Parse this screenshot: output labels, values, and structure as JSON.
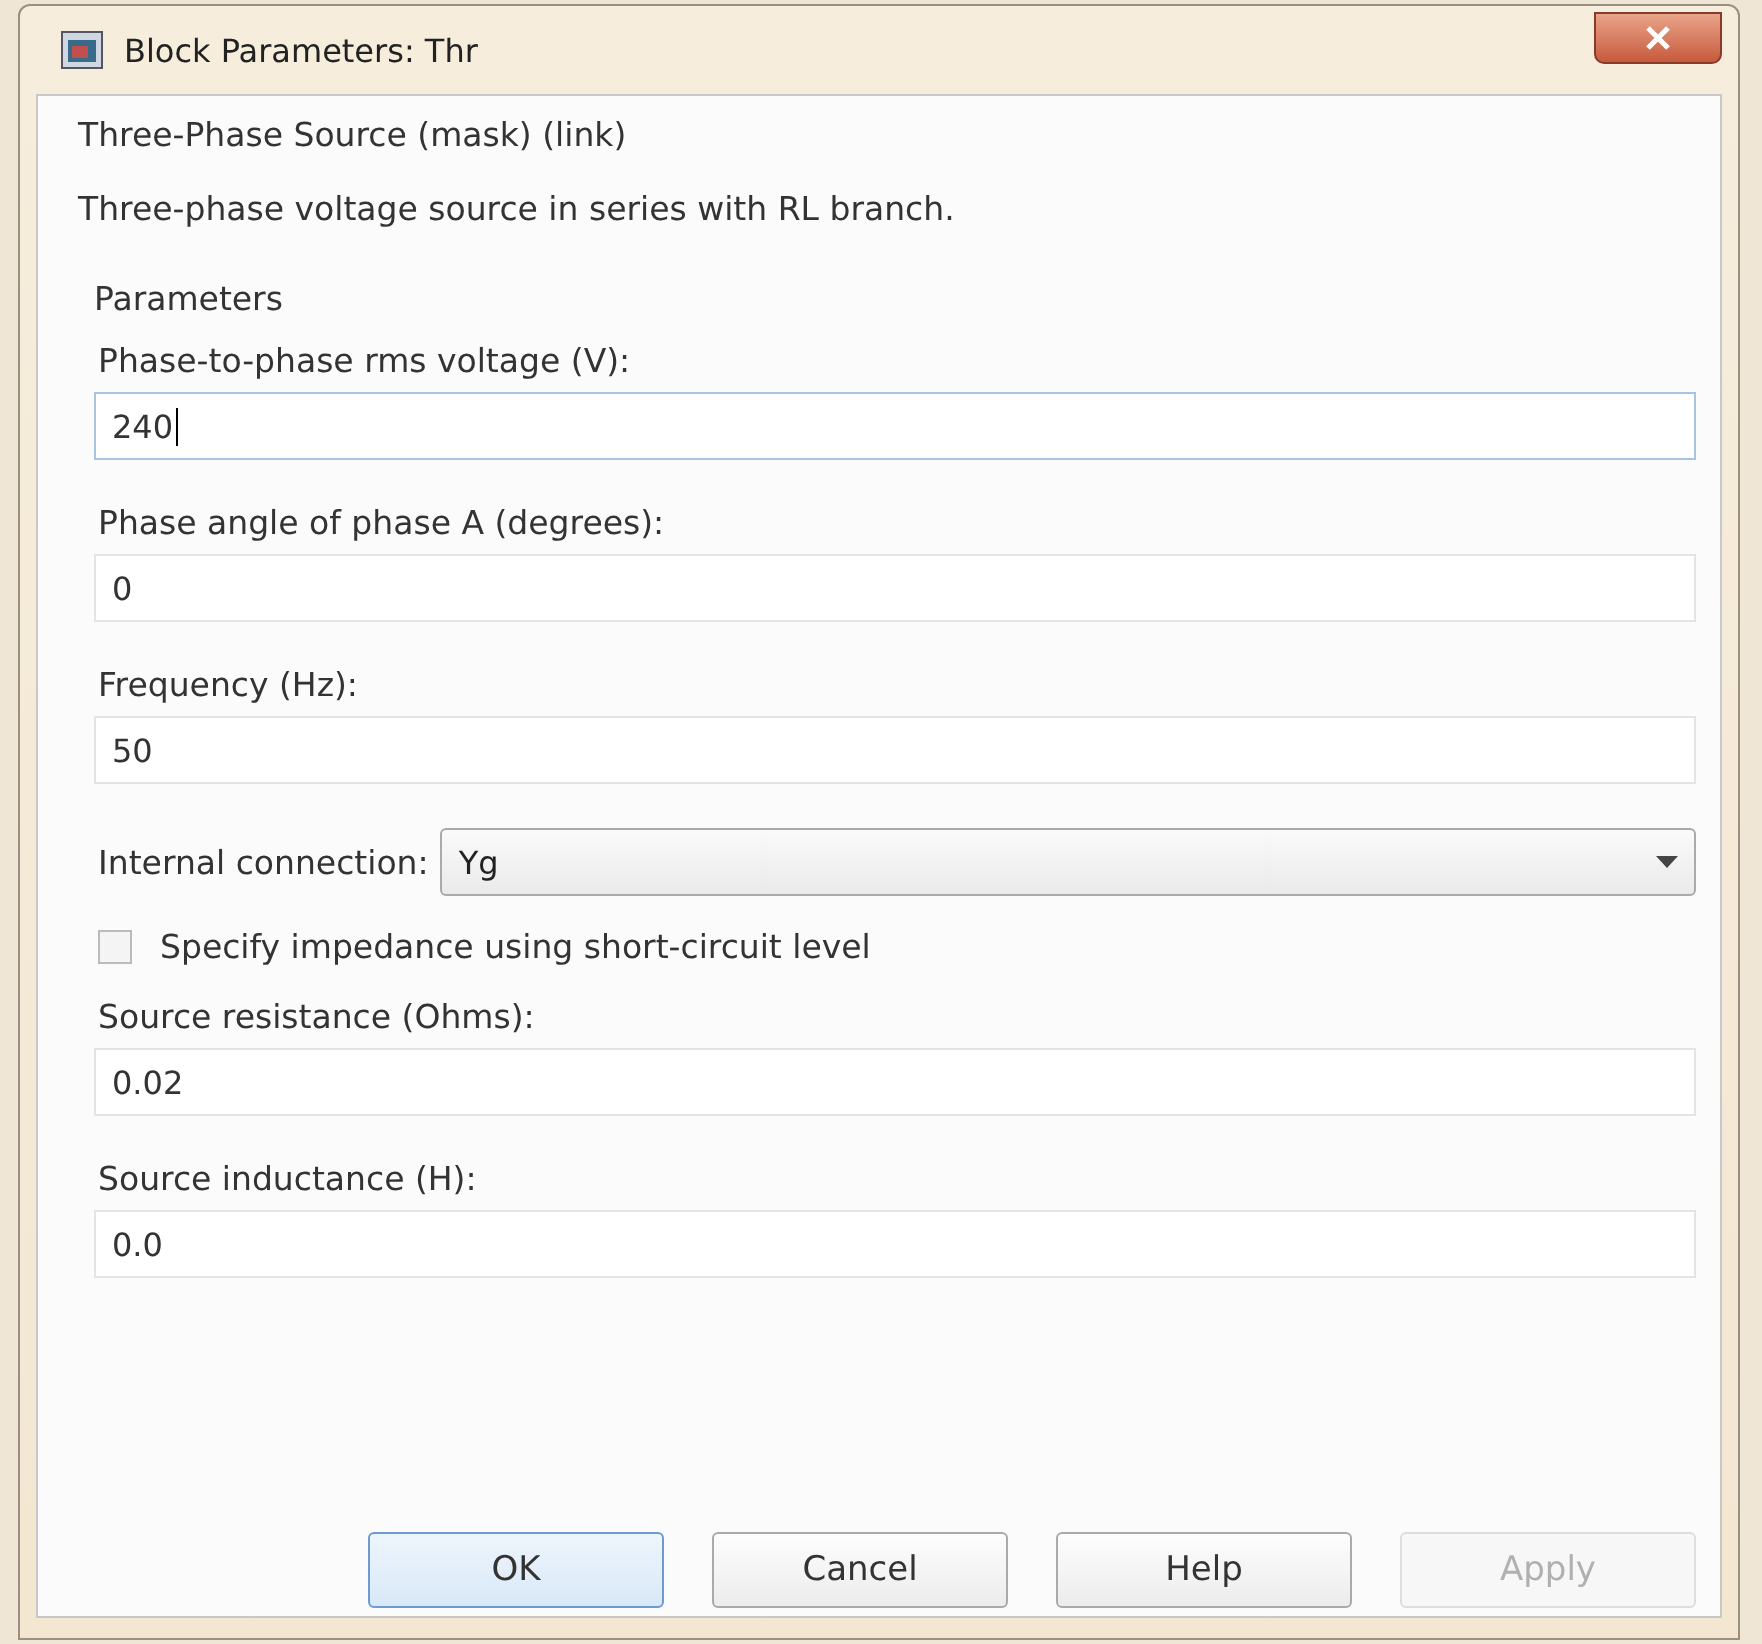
{
  "window": {
    "title": "Block Parameters: Thr"
  },
  "block_type": "Three-Phase Source (mask) (link)",
  "description": "Three-phase voltage source in series with RL branch.",
  "section_title": "Parameters",
  "parameters": [
    {
      "kind": "text",
      "label": "Phase-to-phase rms voltage (V):",
      "value": "240",
      "focused": true
    },
    {
      "kind": "text",
      "label": "Phase angle of phase A (degrees):",
      "value": "0",
      "focused": false
    },
    {
      "kind": "text",
      "label": "Frequency (Hz):",
      "value": "50",
      "focused": false
    },
    {
      "kind": "dropdown",
      "label": "Internal connection:",
      "value": "Yg"
    },
    {
      "kind": "checkbox",
      "label": "Specify impedance using short-circuit level",
      "checked": false
    },
    {
      "kind": "text",
      "label": "Source resistance (Ohms):",
      "value": "0.02",
      "focused": false
    },
    {
      "kind": "text",
      "label": "Source inductance (H):",
      "value": "0.0",
      "focused": false
    }
  ],
  "buttons": [
    {
      "label": "OK",
      "default": true,
      "disabled": false
    },
    {
      "label": "Cancel",
      "default": false,
      "disabled": false
    },
    {
      "label": "Help",
      "default": false,
      "disabled": false
    },
    {
      "label": "Apply",
      "default": false,
      "disabled": true
    }
  ]
}
